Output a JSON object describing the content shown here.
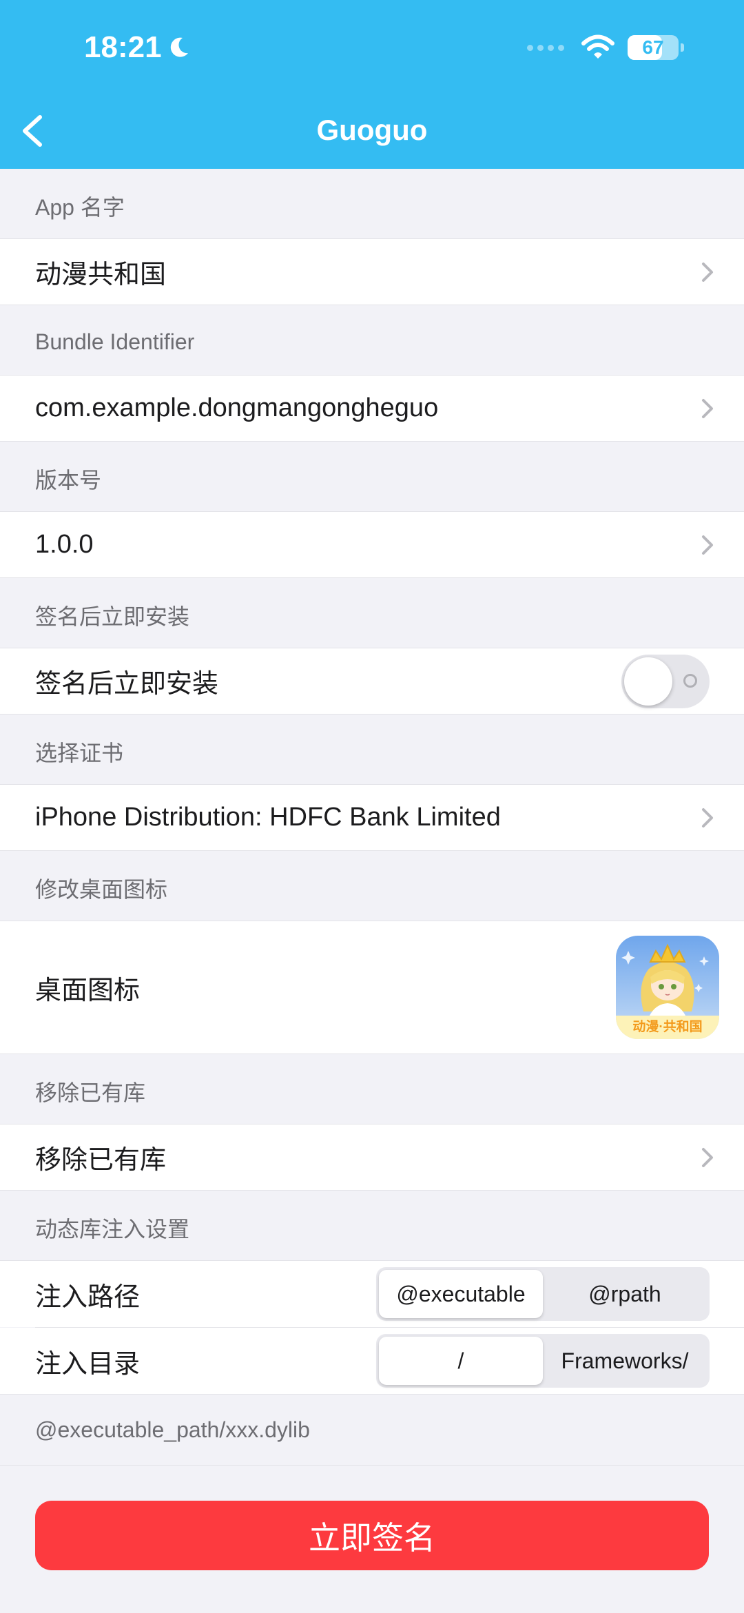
{
  "status": {
    "time": "18:21",
    "battery": "67",
    "battery_level": 0.67
  },
  "nav": {
    "title": "Guoguo"
  },
  "sections": {
    "app_name": {
      "header": "App 名字",
      "value": "动漫共和国"
    },
    "bundle_id": {
      "header": "Bundle Identifier",
      "value": "com.example.dongmangongheguo"
    },
    "version": {
      "header": "版本号",
      "value": "1.0.0"
    },
    "install": {
      "header": "签名后立即安装",
      "label": "签名后立即安装",
      "enabled": false
    },
    "certificate": {
      "header": "选择证书",
      "value": "iPhone Distribution: HDFC Bank Limited"
    },
    "icon": {
      "header": "修改桌面图标",
      "label": "桌面图标",
      "icon_text": "动漫·共和国"
    },
    "remove_libs": {
      "header": "移除已有库",
      "label": "移除已有库"
    },
    "injection": {
      "header": "动态库注入设置",
      "path_label": "注入路径",
      "path_options": [
        "@executable",
        "@rpath"
      ],
      "path_selected": "@executable",
      "dir_label": "注入目录",
      "dir_options": [
        "/",
        "Frameworks/"
      ],
      "dir_selected": "/",
      "footer": "@executable_path/xxx.dylib"
    }
  },
  "action": {
    "sign_label": "立即签名"
  },
  "colors": {
    "nav_bg": "#34bcf2",
    "sign_button": "#fd3a3f",
    "page_bg": "#f2f2f7"
  }
}
